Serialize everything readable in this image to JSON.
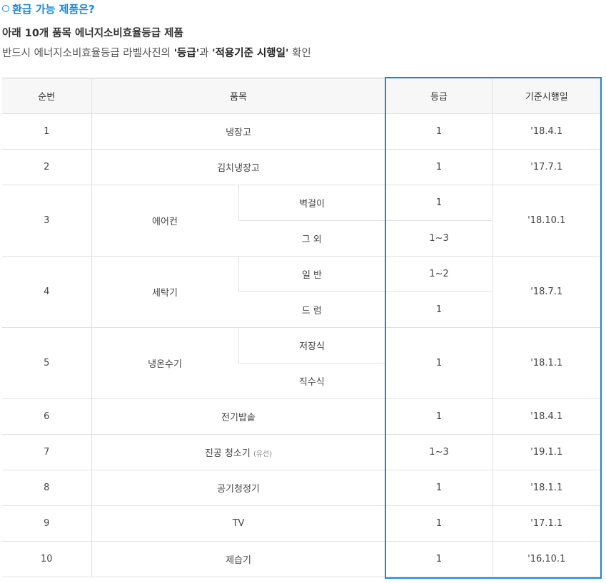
{
  "heading": "환급 가능 제품은?",
  "subtitle": "아래 10개 품목 에너지소비효율등급 제품",
  "description": {
    "prefix": "반드시 에너지소비효율등급 라벨사진의 ",
    "term1": "'등급'",
    "middle": "과 ",
    "term2": "'적용기준 시행일'",
    "suffix": " 확인"
  },
  "table": {
    "headers": {
      "no": "순번",
      "item": "품목",
      "grade": "등급",
      "date": "기준시행일"
    },
    "rows": [
      {
        "no": "1",
        "item": "냉장고",
        "grade": "1",
        "date": "'18.4.1"
      },
      {
        "no": "2",
        "item": "김치냉장고",
        "grade": "1",
        "date": "'17.7.1"
      },
      {
        "no": "3",
        "item": "에어컨",
        "sub1": "벽걸이",
        "grade1": "1",
        "sub2": "그 외",
        "grade2": "1~3",
        "date": "'18.10.1"
      },
      {
        "no": "4",
        "item": "세탁기",
        "sub1": "일 반",
        "grade1": "1~2",
        "sub2": "드 럼",
        "grade2": "1",
        "date": "'18.7.1"
      },
      {
        "no": "5",
        "item": "냉온수기",
        "sub1": "저장식",
        "sub2": "직수식",
        "grade": "1",
        "date": "'18.1.1"
      },
      {
        "no": "6",
        "item": "전기밥솥",
        "grade": "1",
        "date": "'18.4.1"
      },
      {
        "no": "7",
        "item": "진공 청소기",
        "item_note": "(유선)",
        "grade": "1~3",
        "date": "'19.1.1"
      },
      {
        "no": "8",
        "item": "공기청정기",
        "grade": "1",
        "date": "'18.1.1"
      },
      {
        "no": "9",
        "item": "TV",
        "grade": "1",
        "date": "'17.1.1"
      },
      {
        "no": "10",
        "item": "제습기",
        "grade": "1",
        "date": "'16.10.1"
      }
    ]
  },
  "colors": {
    "accent": "#1a88d8",
    "header_bg": "#f7f7f7",
    "border": "#e2e2e2"
  }
}
